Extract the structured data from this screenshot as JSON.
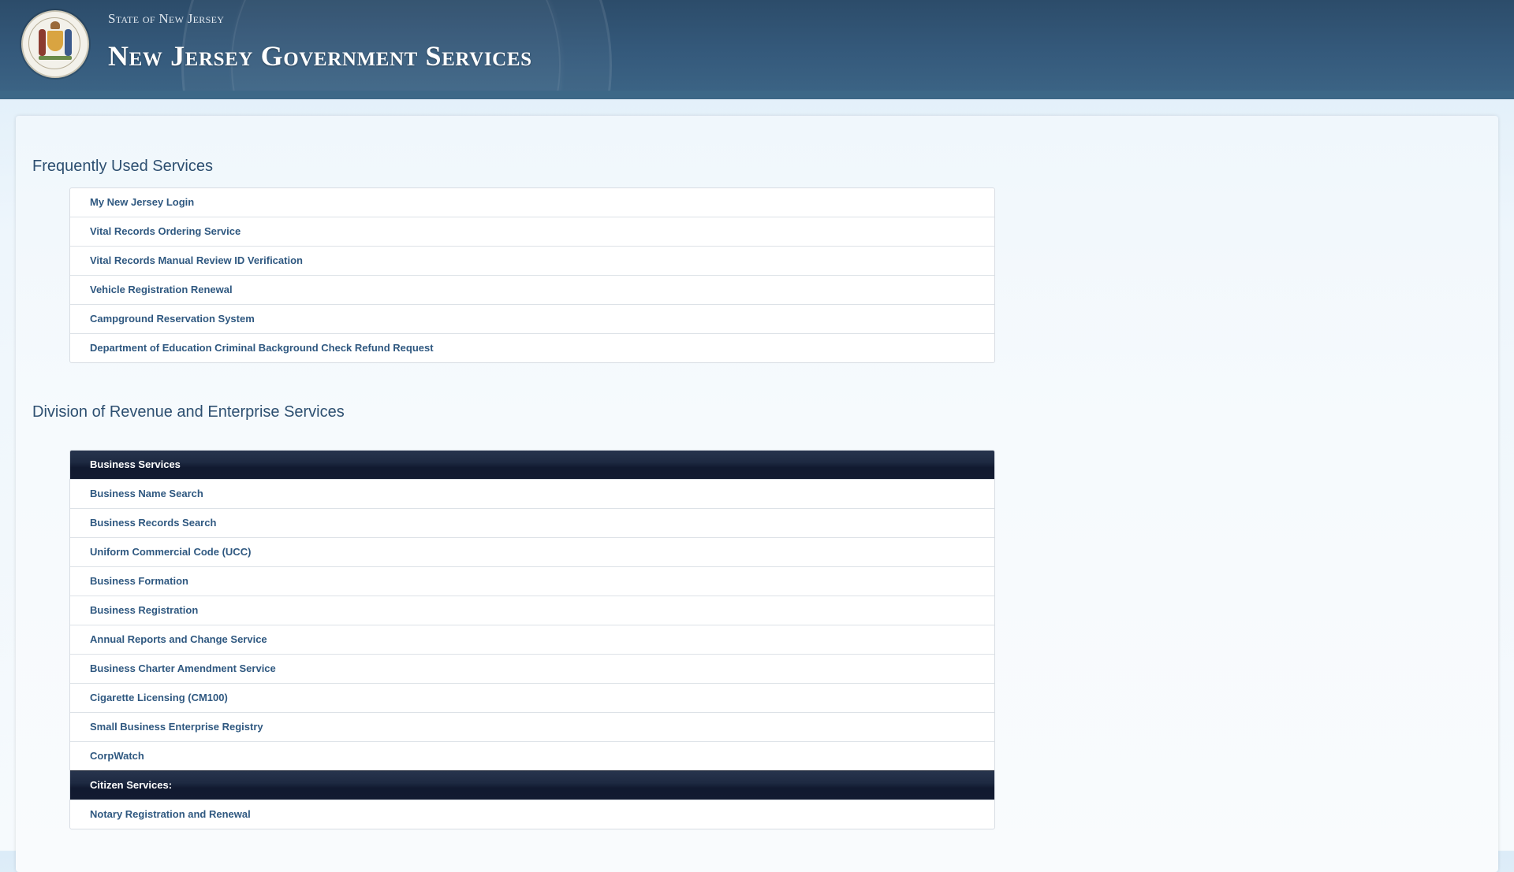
{
  "header": {
    "state_label": "State of New Jersey",
    "site_title": "New Jersey Government Services",
    "seal_icon": "nj-state-seal-icon",
    "colors": {
      "header_bg": "#2c4c6a",
      "group_bar": "#1e2a42",
      "link": "#2f5880"
    }
  },
  "frequent": {
    "title": "Frequently Used Services",
    "items": [
      "My New Jersey Login",
      "Vital Records Ordering Service",
      "Vital Records Manual Review ID Verification",
      "Vehicle Registration Renewal",
      "Campground Reservation System",
      "Department of Education Criminal Background Check Refund Request"
    ]
  },
  "revenue": {
    "title": "Division of Revenue and Enterprise Services",
    "business_group": "Business Services",
    "business_items": [
      "Business Name Search",
      "Business Records Search",
      "Uniform Commercial Code (UCC)",
      "Business Formation",
      "Business Registration",
      "Annual Reports and Change Service",
      "Business Charter Amendment Service",
      "Cigarette Licensing (CM100)",
      "Small Business Enterprise Registry",
      "CorpWatch"
    ],
    "citizen_group": "Citizen Services:",
    "citizen_items": [
      "Notary Registration and Renewal"
    ]
  }
}
